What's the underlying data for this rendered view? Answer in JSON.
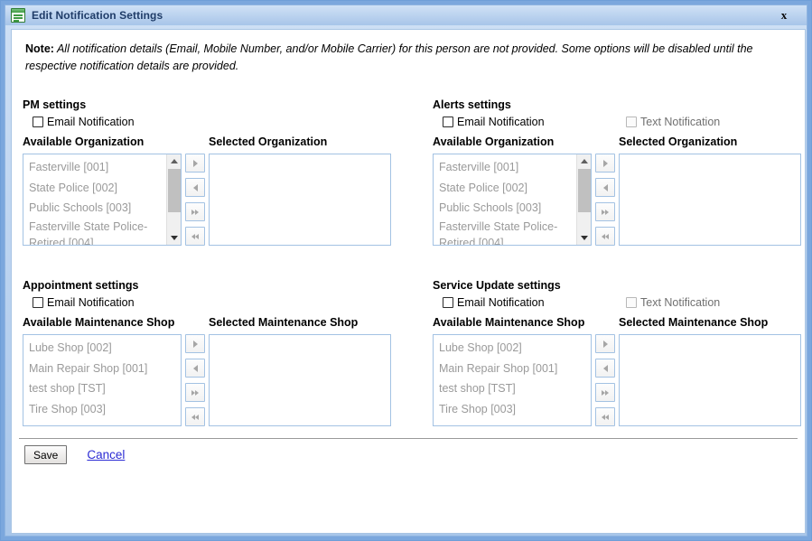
{
  "window": {
    "title": "Edit Notification Settings",
    "icon": "window-list-icon",
    "close_label": "x"
  },
  "note": {
    "label": "Note:",
    "text": " All notification details (Email, Mobile Number, and/or Mobile Carrier) for this person are not provided. Some options will be disabled until the respective notification details are provided."
  },
  "transfer_buttons": {
    "move_right": "▶",
    "move_left": "◀",
    "move_all_right": "▶▶",
    "move_all_left": "◀◀"
  },
  "panels": [
    {
      "id": "pm",
      "title": "PM settings",
      "email_label": "Email Notification",
      "email_checked": false,
      "email_disabled": false,
      "has_text_notification": false,
      "text_label": "",
      "available_header": "Available Organization",
      "selected_header": "Selected Organization",
      "available_items": [
        "Fasterville [001]",
        "State Police [002]",
        "Public Schools [003]",
        "Fasterville State Police-Retired [004]"
      ],
      "selected_items": [],
      "has_scrollbar": true
    },
    {
      "id": "alerts",
      "title": "Alerts settings",
      "email_label": "Email Notification",
      "email_checked": false,
      "email_disabled": false,
      "has_text_notification": true,
      "text_label": "Text Notification",
      "text_checked": false,
      "text_disabled": true,
      "available_header": "Available Organization",
      "selected_header": "Selected Organization",
      "available_items": [
        "Fasterville [001]",
        "State Police [002]",
        "Public Schools [003]",
        "Fasterville State Police-Retired [004]"
      ],
      "selected_items": [],
      "has_scrollbar": true
    },
    {
      "id": "appointment",
      "title": "Appointment settings",
      "email_label": "Email Notification",
      "email_checked": false,
      "email_disabled": false,
      "has_text_notification": false,
      "text_label": "",
      "available_header": "Available Maintenance Shop",
      "selected_header": "Selected Maintenance Shop",
      "available_items": [
        "Lube Shop [002]",
        "Main Repair Shop [001]",
        "test shop [TST]",
        "Tire Shop [003]"
      ],
      "selected_items": [],
      "has_scrollbar": false
    },
    {
      "id": "service-update",
      "title": "Service Update settings",
      "email_label": "Email Notification",
      "email_checked": false,
      "email_disabled": false,
      "has_text_notification": true,
      "text_label": "Text Notification",
      "text_checked": false,
      "text_disabled": true,
      "available_header": "Available Maintenance Shop",
      "selected_header": "Selected Maintenance Shop",
      "available_items": [
        "Lube Shop [002]",
        "Main Repair Shop [001]",
        "test shop [TST]",
        "Tire Shop [003]"
      ],
      "selected_items": [],
      "has_scrollbar": false
    }
  ],
  "footer": {
    "save_label": "Save",
    "cancel_label": "Cancel"
  },
  "colors": {
    "window_frame": "#7ba7dd",
    "title_text": "#1f3c68",
    "link": "#2b2bd4",
    "disabled_text": "#9a9a9a",
    "listbox_border": "#a3c2e3"
  }
}
